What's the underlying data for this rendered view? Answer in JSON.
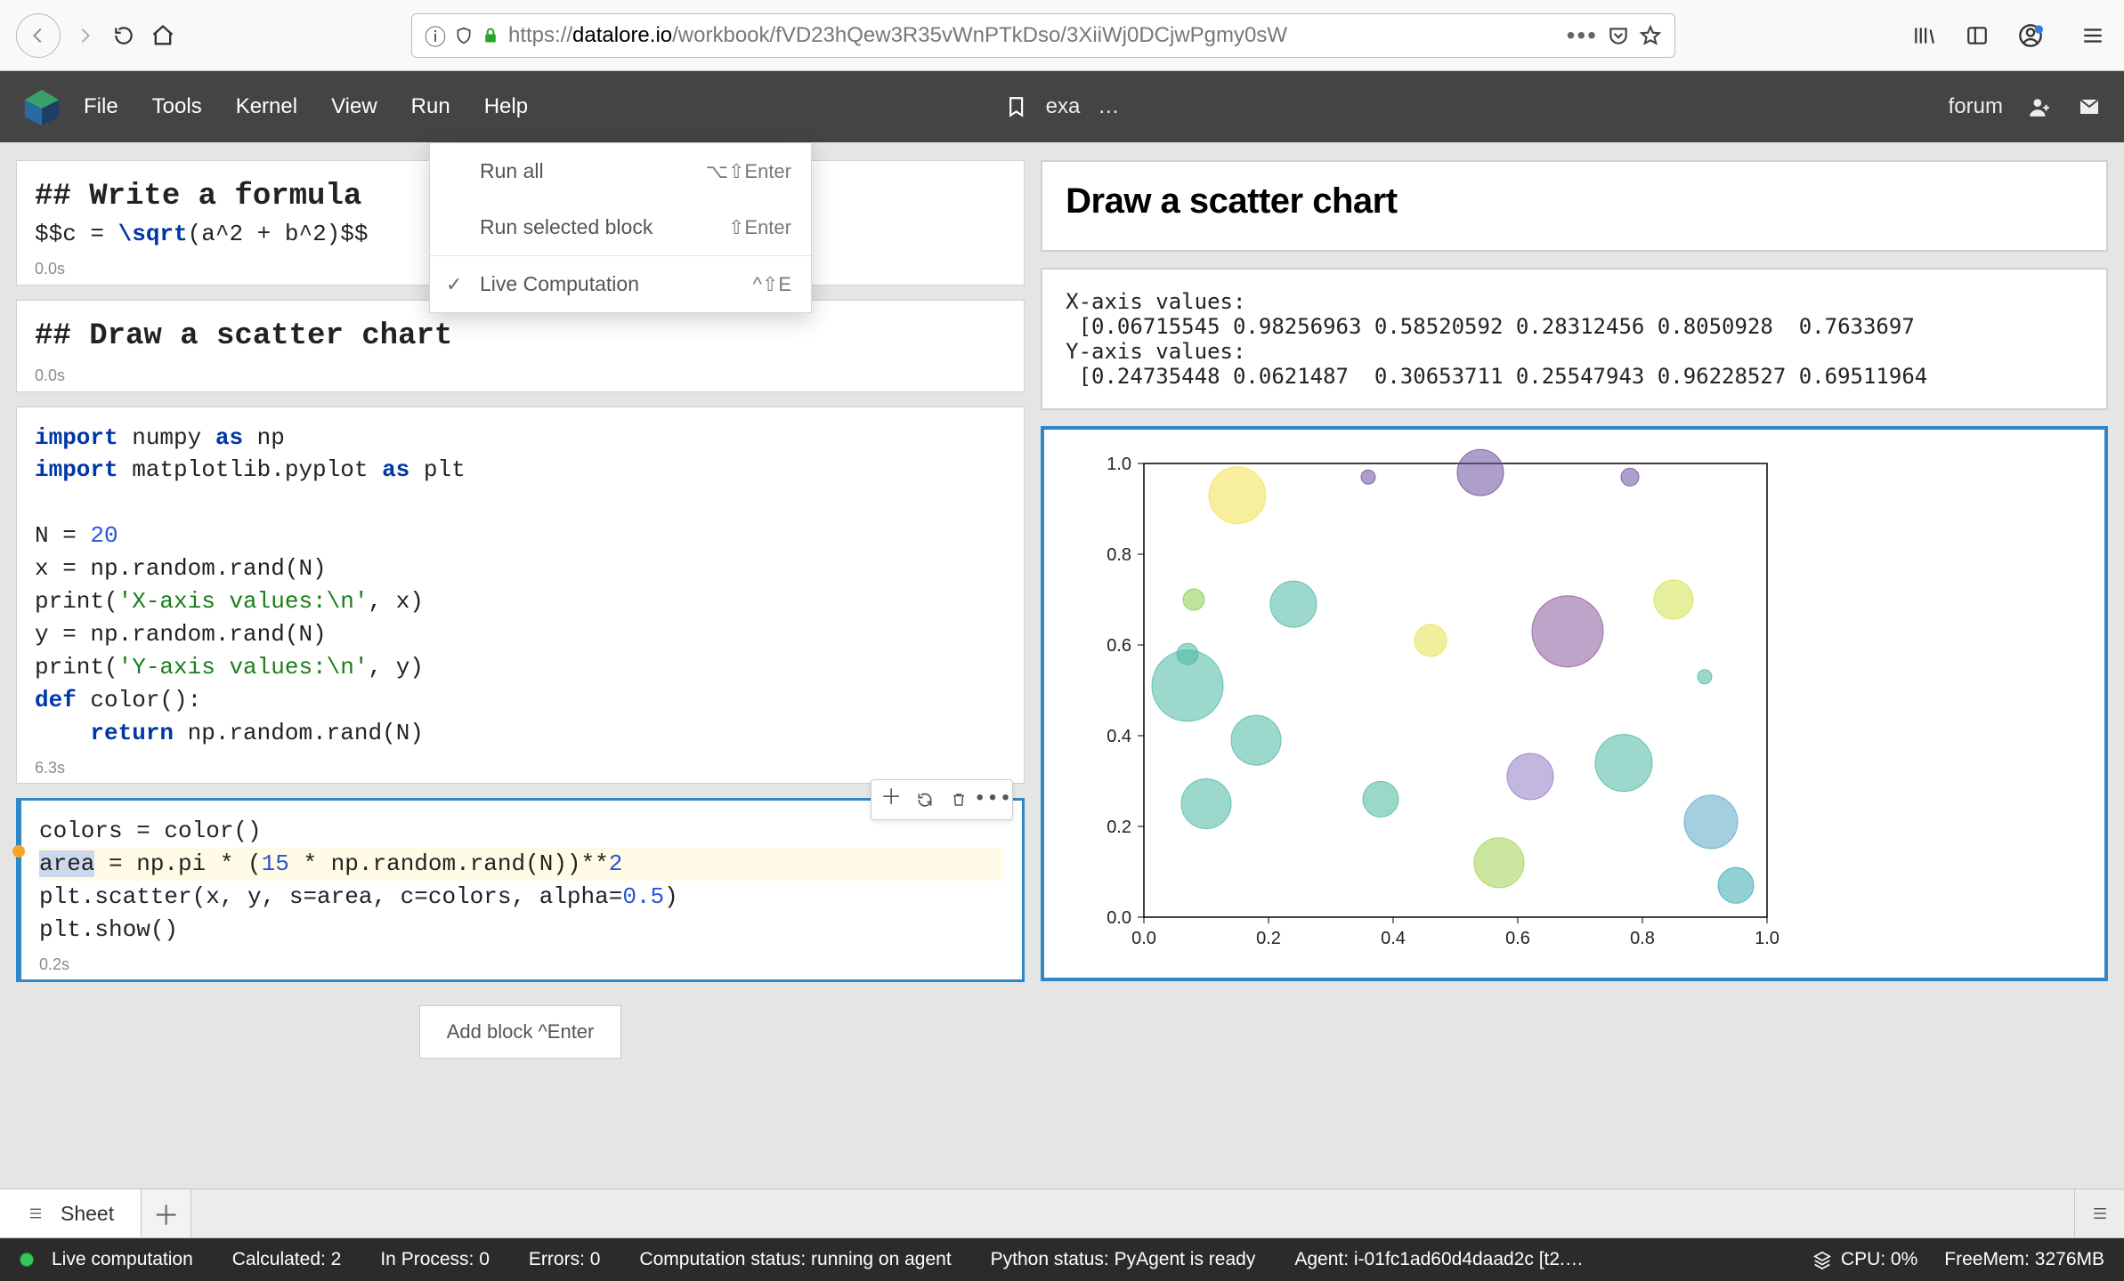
{
  "browser": {
    "url_host": "datalore.io",
    "url_path": "/workbook/fVD23hQew3R35vWnPTkDso/3XiiWj0DCjwPgmy0sW",
    "url_scheme": "https://"
  },
  "menubar": {
    "items": [
      "File",
      "Tools",
      "Kernel",
      "View",
      "Run",
      "Help"
    ],
    "center_label": "exa",
    "center_ellipsis": "…",
    "right_link": "forum"
  },
  "run_menu": {
    "items": [
      {
        "label": "Run all",
        "shortcut": "⌥⇧Enter",
        "checked": false
      },
      {
        "label": "Run selected block",
        "shortcut": "⇧Enter",
        "checked": false
      },
      {
        "label": "Live Computation",
        "shortcut": "^⇧E",
        "checked": true
      }
    ]
  },
  "cells": {
    "md1": {
      "source": "## Write a formula",
      "formula": "$$c = \\sqrt(a^2 + b^2)$$",
      "time": "0.0s"
    },
    "md2": {
      "source": "## Draw a scatter chart",
      "time": "0.0s"
    },
    "code1_time": "6.3s",
    "code1": [
      "import numpy as np",
      "import matplotlib.pyplot as plt",
      "",
      "N = 20",
      "x = np.random.rand(N)",
      "print('X-axis values:\\n', x)",
      "y = np.random.rand(N)",
      "print('Y-axis values:\\n', y)",
      "def color():",
      "    return np.random.rand(N)"
    ],
    "code2_time": "0.2s",
    "code2": [
      "colors = color()",
      "area = np.pi * (15 * np.random.rand(N))**2",
      "plt.scatter(x, y, s=area, c=colors, alpha=0.5)",
      "plt.show()"
    ],
    "add_block_label": "Add block ^Enter"
  },
  "output": {
    "heading": "Draw a scatter chart",
    "text": "X-axis values:\n [0.06715545 0.98256963 0.58520592 0.28312456 0.8050928  0.7633697\nY-axis values:\n [0.24735448 0.0621487  0.30653711 0.25547943 0.96228527 0.69511964"
  },
  "sheet": {
    "tab": "Sheet"
  },
  "status": {
    "live": "Live computation",
    "calculated": "Calculated: 2",
    "inprocess": "In Process: 0",
    "errors": "Errors: 0",
    "comp": "Computation status: running on agent",
    "python": "Python status: PyAgent is ready",
    "agent": "Agent: i-01fc1ad60d4daad2c [t2.…",
    "cpu": "CPU: 0%",
    "mem": "FreeMem: 3276MB"
  },
  "chart_data": {
    "type": "scatter",
    "xlabel": "",
    "ylabel": "",
    "xlim": [
      0.0,
      1.0
    ],
    "ylim": [
      0.0,
      1.0
    ],
    "xticks": [
      0.0,
      0.2,
      0.4,
      0.6,
      0.8,
      1.0
    ],
    "yticks": [
      0.0,
      0.2,
      0.4,
      0.6,
      0.8,
      1.0
    ],
    "points": [
      {
        "x": 0.07,
        "y": 0.58,
        "r": 12,
        "c": "#4db8a3"
      },
      {
        "x": 0.07,
        "y": 0.51,
        "r": 40,
        "c": "#4db8a3"
      },
      {
        "x": 0.1,
        "y": 0.25,
        "r": 28,
        "c": "#4db8a3"
      },
      {
        "x": 0.08,
        "y": 0.7,
        "r": 12,
        "c": "#86cc4d"
      },
      {
        "x": 0.15,
        "y": 0.93,
        "r": 32,
        "c": "#f1e24f"
      },
      {
        "x": 0.18,
        "y": 0.39,
        "r": 28,
        "c": "#4db8a3"
      },
      {
        "x": 0.24,
        "y": 0.69,
        "r": 26,
        "c": "#4db8a3"
      },
      {
        "x": 0.36,
        "y": 0.97,
        "r": 8,
        "c": "#6b4fa0"
      },
      {
        "x": 0.38,
        "y": 0.26,
        "r": 20,
        "c": "#47b89f"
      },
      {
        "x": 0.46,
        "y": 0.61,
        "r": 18,
        "c": "#e2e24f"
      },
      {
        "x": 0.54,
        "y": 0.98,
        "r": 26,
        "c": "#6b4fa0"
      },
      {
        "x": 0.57,
        "y": 0.12,
        "r": 28,
        "c": "#a0d24f"
      },
      {
        "x": 0.62,
        "y": 0.31,
        "r": 26,
        "c": "#8f7bc3"
      },
      {
        "x": 0.68,
        "y": 0.63,
        "r": 40,
        "c": "#8a5a9e"
      },
      {
        "x": 0.77,
        "y": 0.34,
        "r": 32,
        "c": "#4db8a3"
      },
      {
        "x": 0.78,
        "y": 0.97,
        "r": 10,
        "c": "#6b4fa0"
      },
      {
        "x": 0.85,
        "y": 0.7,
        "r": 22,
        "c": "#d0e24f"
      },
      {
        "x": 0.9,
        "y": 0.53,
        "r": 8,
        "c": "#4db8a3"
      },
      {
        "x": 0.91,
        "y": 0.21,
        "r": 30,
        "c": "#5aa8c7"
      },
      {
        "x": 0.95,
        "y": 0.07,
        "r": 20,
        "c": "#38aab1"
      }
    ]
  }
}
